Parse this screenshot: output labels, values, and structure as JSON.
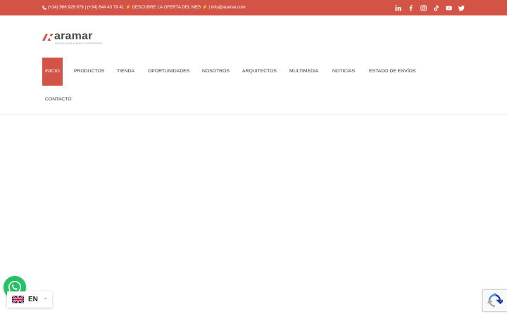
{
  "topbar": {
    "contact_text": "(+34) 966 928 979 | (+34) 644 43 79 41 ⚡ DESCUBRE LA OFERTA DEL MES ⚡ | info@aramar.com",
    "social_icons": [
      "linkedin-icon",
      "facebook-icon",
      "instagram-icon",
      "tiktok-icon",
      "youtube-icon",
      "twitter-icon"
    ],
    "background_color": "#d35446"
  },
  "logo": {
    "wordmark": "aramar",
    "tagline": "DESIGN FOR ALWAYS EXPERIENCE"
  },
  "nav": {
    "items": [
      {
        "label": "INICIO",
        "active": true
      },
      {
        "label": "PRODUCTOS",
        "active": false
      },
      {
        "label": "TIENDA",
        "active": false
      },
      {
        "label": "OPORTUNIDADES",
        "active": false
      },
      {
        "label": "NOSOTROS",
        "active": false
      },
      {
        "label": "ARQUITECTOS",
        "active": false
      },
      {
        "label": "MULTIMEDIA",
        "active": false
      },
      {
        "label": "NOTICIAS",
        "active": false
      },
      {
        "label": "ESTADO DE ENVÍOS",
        "active": false
      },
      {
        "label": "CONTACTO",
        "active": false
      }
    ],
    "accent_color": "#d35446"
  },
  "widgets": {
    "language_code": "EN",
    "whatsapp_color": "#27c165"
  }
}
